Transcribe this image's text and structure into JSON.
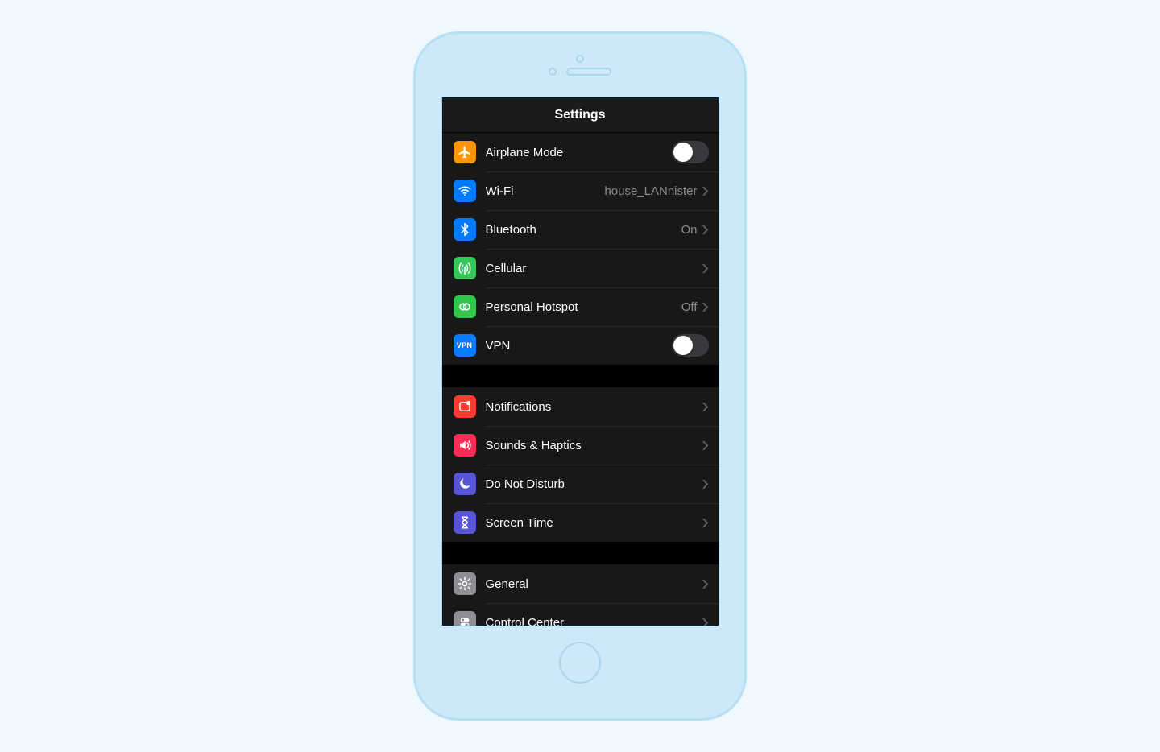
{
  "header": {
    "title": "Settings"
  },
  "groups": [
    {
      "rows": [
        {
          "icon": "airplane-icon",
          "label": "Airplane Mode",
          "control": "toggle",
          "toggle_on": false
        },
        {
          "icon": "wifi-icon",
          "label": "Wi-Fi",
          "value": "house_LANnister",
          "control": "disclosure"
        },
        {
          "icon": "bluetooth-icon",
          "label": "Bluetooth",
          "value": "On",
          "control": "disclosure"
        },
        {
          "icon": "cellular-icon",
          "label": "Cellular",
          "control": "disclosure"
        },
        {
          "icon": "hotspot-icon",
          "label": "Personal Hotspot",
          "value": "Off",
          "control": "disclosure"
        },
        {
          "icon": "vpn-icon",
          "label": "VPN",
          "control": "toggle",
          "toggle_on": false,
          "icon_text": "VPN"
        }
      ]
    },
    {
      "rows": [
        {
          "icon": "notifications-icon",
          "label": "Notifications",
          "control": "disclosure"
        },
        {
          "icon": "sounds-icon",
          "label": "Sounds & Haptics",
          "control": "disclosure"
        },
        {
          "icon": "dnd-icon",
          "label": "Do Not Disturb",
          "control": "disclosure"
        },
        {
          "icon": "screentime-icon",
          "label": "Screen Time",
          "control": "disclosure"
        }
      ]
    },
    {
      "rows": [
        {
          "icon": "general-icon",
          "label": "General",
          "control": "disclosure"
        },
        {
          "icon": "controlcenter-icon",
          "label": "Control Center",
          "control": "disclosure"
        }
      ]
    }
  ]
}
